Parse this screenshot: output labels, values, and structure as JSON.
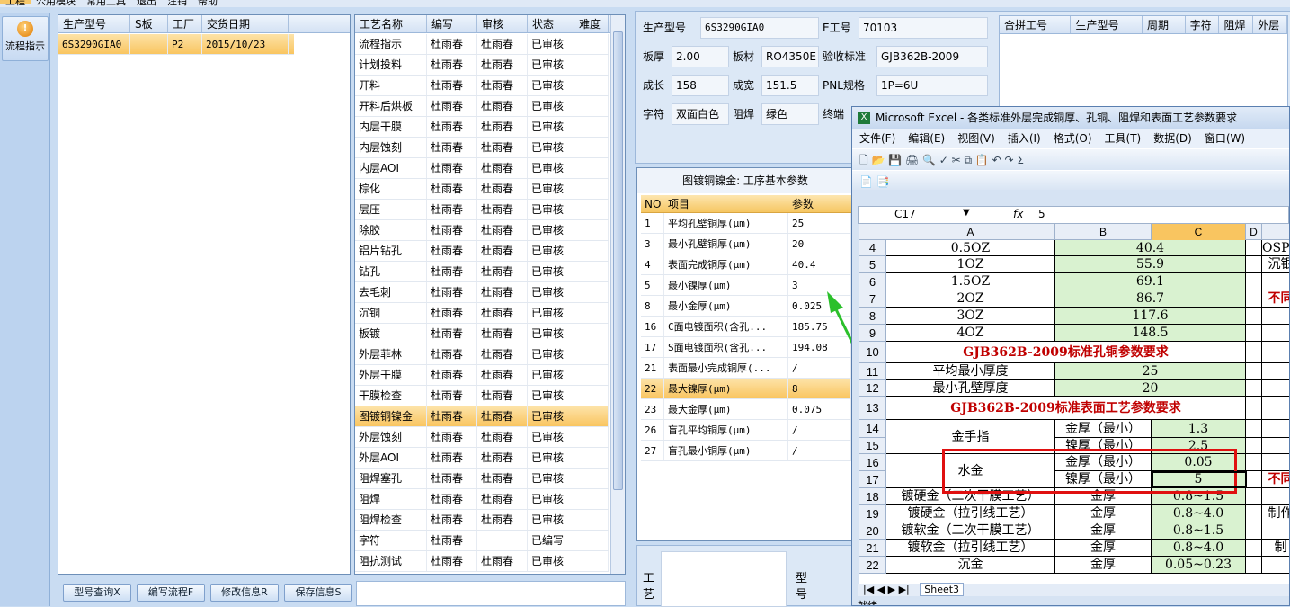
{
  "topmenu": {
    "items": [
      "工程",
      "公用模块",
      "常用工具",
      "退出",
      "注销",
      "帮助"
    ]
  },
  "flow_button": {
    "label": "流程指示"
  },
  "model_list": {
    "headers": [
      "生产型号",
      "S板",
      "工厂",
      "交货日期"
    ],
    "rows": [
      [
        "6S3290GIA0",
        "",
        "P2",
        "2015/10/23"
      ]
    ]
  },
  "process_list": {
    "headers": [
      "工艺名称",
      "编写",
      "审核",
      "状态",
      "难度"
    ],
    "rows": [
      [
        "流程指示",
        "杜雨春",
        "杜雨春",
        "已审核"
      ],
      [
        "计划投料",
        "杜雨春",
        "杜雨春",
        "已审核"
      ],
      [
        "开料",
        "杜雨春",
        "杜雨春",
        "已审核"
      ],
      [
        "开料后烘板",
        "杜雨春",
        "杜雨春",
        "已审核"
      ],
      [
        "内层干膜",
        "杜雨春",
        "杜雨春",
        "已审核"
      ],
      [
        "内层蚀刻",
        "杜雨春",
        "杜雨春",
        "已审核"
      ],
      [
        "内层AOI",
        "杜雨春",
        "杜雨春",
        "已审核"
      ],
      [
        "棕化",
        "杜雨春",
        "杜雨春",
        "已审核"
      ],
      [
        "层压",
        "杜雨春",
        "杜雨春",
        "已审核"
      ],
      [
        "除胶",
        "杜雨春",
        "杜雨春",
        "已审核"
      ],
      [
        "铝片钻孔",
        "杜雨春",
        "杜雨春",
        "已审核"
      ],
      [
        "钻孔",
        "杜雨春",
        "杜雨春",
        "已审核"
      ],
      [
        "去毛刺",
        "杜雨春",
        "杜雨春",
        "已审核"
      ],
      [
        "沉铜",
        "杜雨春",
        "杜雨春",
        "已审核"
      ],
      [
        "板镀",
        "杜雨春",
        "杜雨春",
        "已审核"
      ],
      [
        "外层菲林",
        "杜雨春",
        "杜雨春",
        "已审核"
      ],
      [
        "外层干膜",
        "杜雨春",
        "杜雨春",
        "已审核"
      ],
      [
        "干膜检查",
        "杜雨春",
        "杜雨春",
        "已审核"
      ],
      [
        "图镀铜镍金",
        "杜雨春",
        "杜雨春",
        "已审核"
      ],
      [
        "外层蚀刻",
        "杜雨春",
        "杜雨春",
        "已审核"
      ],
      [
        "外层AOI",
        "杜雨春",
        "杜雨春",
        "已审核"
      ],
      [
        "阻焊塞孔",
        "杜雨春",
        "杜雨春",
        "已审核"
      ],
      [
        "阻焊",
        "杜雨春",
        "杜雨春",
        "已审核"
      ],
      [
        "阻焊检查",
        "杜雨春",
        "杜雨春",
        "已审核"
      ],
      [
        "字符",
        "杜雨春",
        "",
        "已编写"
      ],
      [
        "阻抗测试",
        "杜雨春",
        "杜雨春",
        "已审核"
      ]
    ]
  },
  "buttons": {
    "query": "型号查询X",
    "write": "编写流程F",
    "modify": "修改信息R",
    "save": "保存信息S"
  },
  "info": {
    "model_lbl": "生产型号",
    "model_val": "6S3290GIA0",
    "ework_lbl": "E工号",
    "ework_val": "70103",
    "thick_lbl": "板厚",
    "thick_val": "2.00",
    "mat_lbl": "板材",
    "mat_val": "RO4350E",
    "std_lbl": "验收标准",
    "std_val": "GJB362B-2009",
    "len_lbl": "成长",
    "len_val": "158",
    "wid_lbl": "成宽",
    "wid_val": "151.5",
    "pnl_lbl": "PNL规格",
    "pnl_val": "1P=6U",
    "char_lbl": "字符",
    "char_val": "双面白色",
    "mask_lbl": "阻焊",
    "mask_val": "绿色",
    "end_lbl": "终端"
  },
  "merge_table": {
    "headers": [
      "合拼工号",
      "生产型号",
      "周期",
      "字符",
      "阻焊",
      "外层"
    ]
  },
  "params": {
    "title": "图镀铜镍金: 工序基本参数",
    "headers": [
      "NO",
      "项目",
      "参数"
    ],
    "rows": [
      [
        "1",
        "平均孔壁铜厚(μm)",
        "25"
      ],
      [
        "3",
        "最小孔壁铜厚(μm)",
        "20"
      ],
      [
        "4",
        "表面完成铜厚(μm)",
        "40.4"
      ],
      [
        "5",
        "最小镍厚(μm)",
        "3"
      ],
      [
        "8",
        "最小金厚(μm)",
        "0.025"
      ],
      [
        "16",
        "C面电镀面积(含孔...",
        "185.75"
      ],
      [
        "17",
        "S面电镀面积(含孔...",
        "194.08"
      ],
      [
        "21",
        "表面最小完成铜厚(...",
        "/"
      ],
      [
        "22",
        "最大镍厚(μm)",
        "8"
      ],
      [
        "23",
        "最大金厚(μm)",
        "0.075"
      ],
      [
        "26",
        "盲孔平均铜厚(μm)",
        "/"
      ],
      [
        "27",
        "盲孔最小铜厚(μm)",
        "/"
      ]
    ]
  },
  "bottom_labels": {
    "a": "工艺",
    "b": "型号"
  },
  "excel": {
    "title": "Microsoft Excel - 各类标准外层完成铜厚、孔铜、阻焊和表面工艺参数要求",
    "menu": [
      "文件(F)",
      "编辑(E)",
      "视图(V)",
      "插入(I)",
      "格式(O)",
      "工具(T)",
      "数据(D)",
      "窗口(W)"
    ],
    "cellref": "C17",
    "fx": "5",
    "cols": [
      "A",
      "B",
      "C",
      "D"
    ],
    "sheet": "Sheet3",
    "status": "就绪",
    "r4": [
      "0.5OZ",
      "40.4",
      "OSP厚"
    ],
    "r5": [
      "1OZ",
      "55.9",
      "沉银"
    ],
    "r6": [
      "1.5OZ",
      "69.1"
    ],
    "r7": [
      "2OZ",
      "86.7",
      "不同"
    ],
    "r8": [
      "3OZ",
      "117.6"
    ],
    "r9": [
      "4OZ",
      "148.5"
    ],
    "r10": "GJB362B-2009标准孔铜参数要求",
    "r11": [
      "平均最小厚度",
      "25"
    ],
    "r12": [
      "最小孔壁厚度",
      "20"
    ],
    "r13": "GJB362B-2009标准表面工艺参数要求",
    "r14": [
      "金手指",
      "金厚（最小）",
      "1.3"
    ],
    "r15": [
      "镍厚（最小）",
      "2.5"
    ],
    "r16": [
      "水金",
      "金厚（最小）",
      "0.05"
    ],
    "r17": [
      "镍厚（最小）",
      "5",
      "不同"
    ],
    "r18": [
      "镀硬金（二次干膜工艺）",
      "金厚",
      "0.8~1.5"
    ],
    "r19": [
      "镀硬金（拉引线工艺）",
      "金厚",
      "0.8~4.0",
      "制作"
    ],
    "r20": [
      "镀软金（二次干膜工艺）",
      "金厚",
      "0.8~1.5"
    ],
    "r21": [
      "镀软金（拉引线工艺）",
      "金厚",
      "0.8~4.0",
      "制"
    ],
    "r22": [
      "沉金",
      "金厚",
      "0.05~0.23"
    ]
  }
}
